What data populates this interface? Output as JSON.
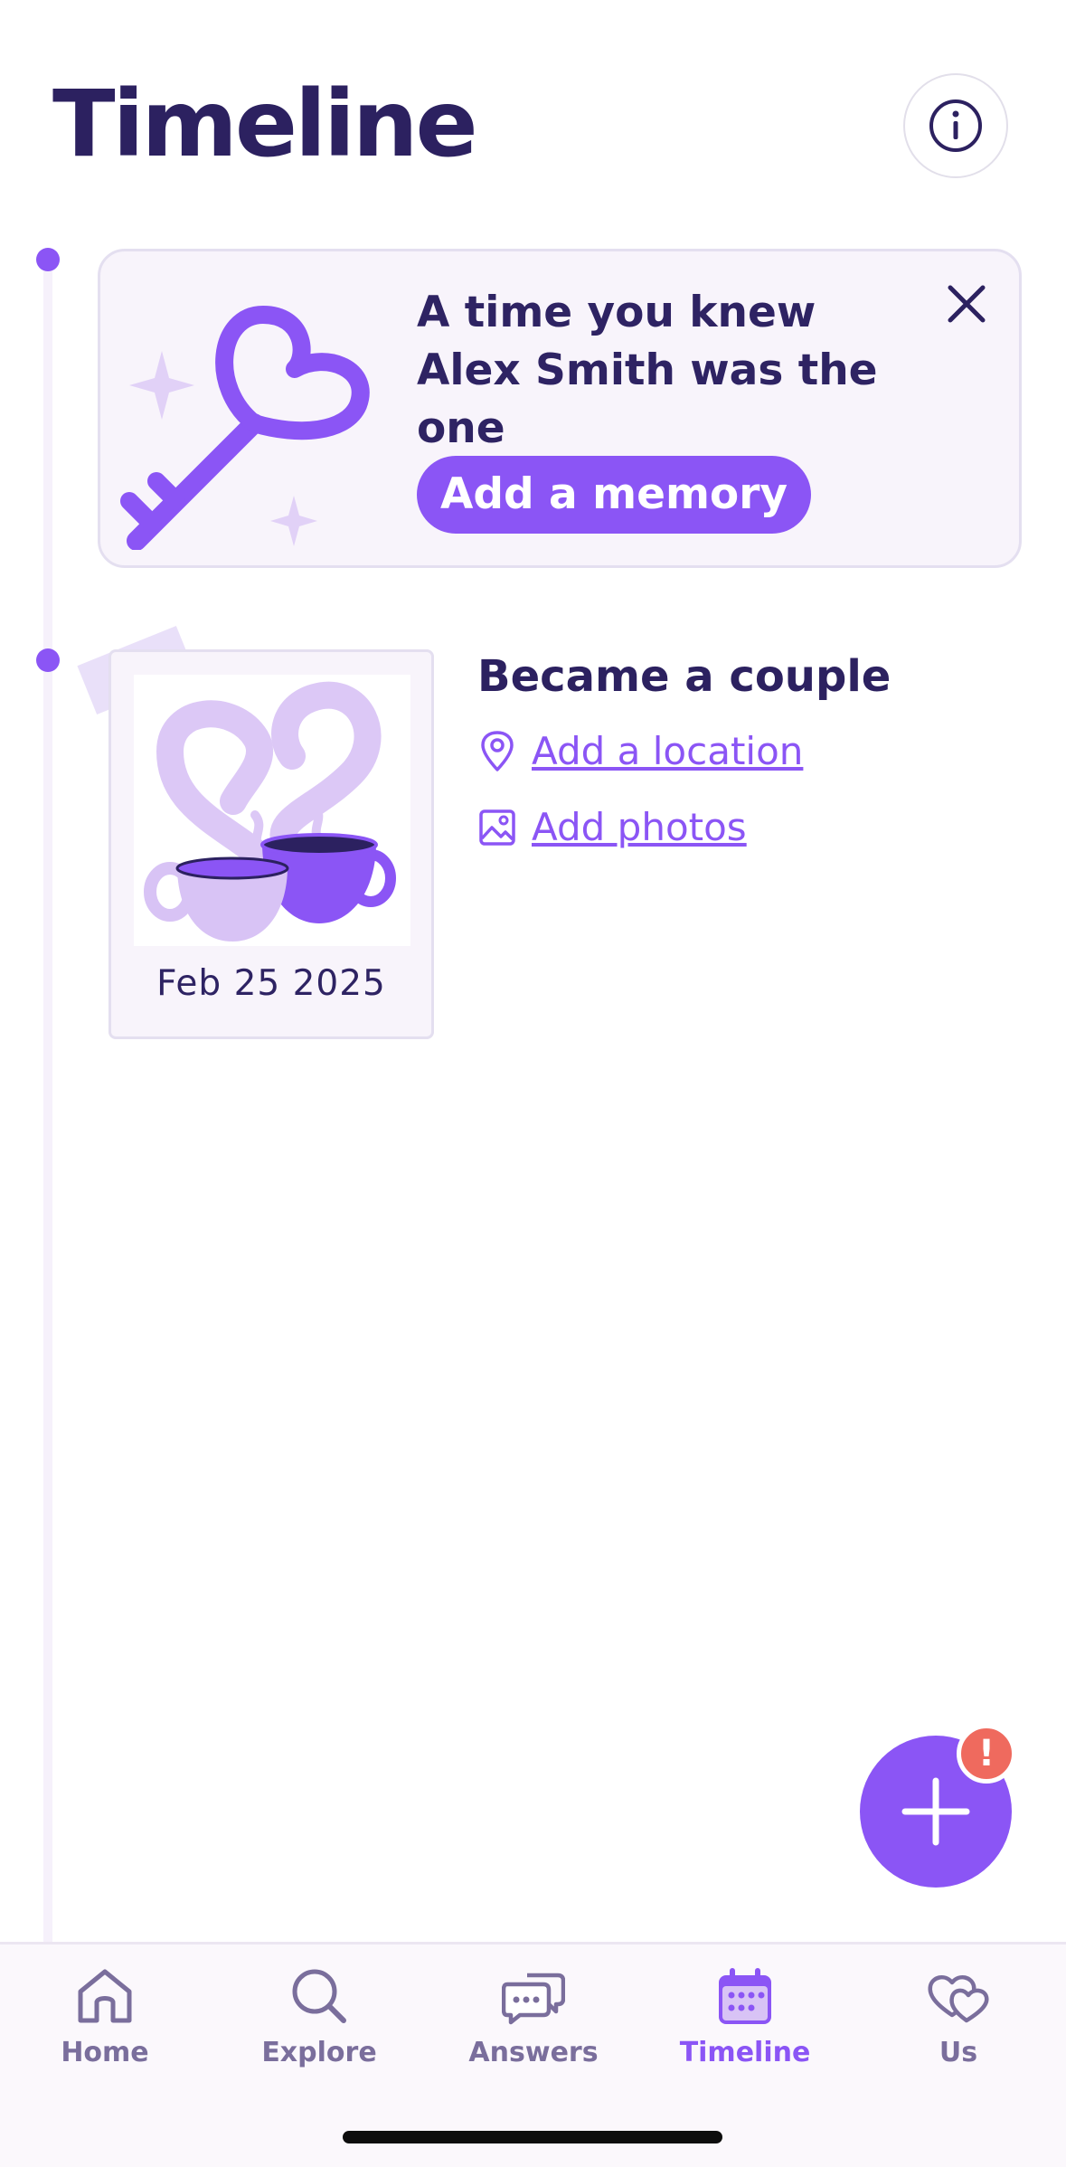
{
  "header": {
    "title": "Timeline"
  },
  "prompt_card": {
    "text": "A time you knew Alex Smith was the one",
    "button_label": "Add a memory"
  },
  "event": {
    "date": "Feb 25 2025",
    "title": "Became a couple",
    "location_link": "Add a location",
    "photos_link": "Add photos"
  },
  "fab": {
    "badge": "!"
  },
  "nav": {
    "items": [
      {
        "label": "Home",
        "icon": "home-icon"
      },
      {
        "label": "Explore",
        "icon": "search-icon"
      },
      {
        "label": "Answers",
        "icon": "chat-bubbles-icon"
      },
      {
        "label": "Timeline",
        "icon": "calendar-icon",
        "active": true
      },
      {
        "label": "Us",
        "icon": "hearts-icon"
      }
    ]
  },
  "colors": {
    "accent": "#8b55f5",
    "title": "#2c2160",
    "nav_inactive": "#7a6e9c",
    "badge": "#ef6a5e"
  }
}
